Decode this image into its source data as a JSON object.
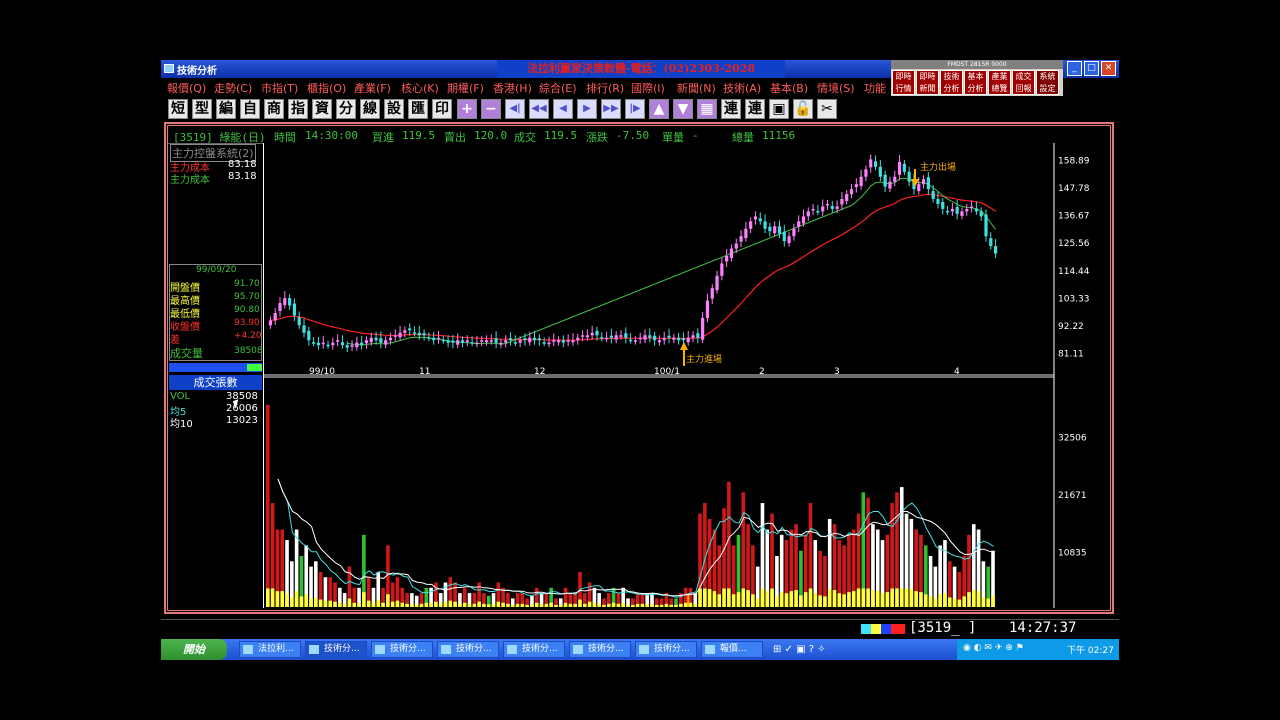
{
  "window": {
    "title": "技術分析",
    "ad_title": "法拉利贏家決策軟體-電話：(02)2303-2028"
  },
  "quick_panel": {
    "header": "FMDST 2815R 0000",
    "buttons": [
      "即時行情",
      "即時新聞",
      "技術分析",
      "基本分析",
      "產業總覽",
      "成交回報",
      "系統設定"
    ]
  },
  "menu": [
    "報價(Q)",
    "走勢(C)",
    "市指(T)",
    "櫃指(O)",
    "產業(F)",
    "核心(K)",
    "期權(F)",
    "香港(H)",
    "綜合(E)",
    "排行(R)",
    "國際(I)",
    "新聞(N)",
    "技術(A)",
    "基本(B)",
    "情境(S)",
    "功能"
  ],
  "toolbar": [
    "短",
    "型",
    "編",
    "自",
    "商",
    "指",
    "資",
    "分",
    "線",
    "設",
    "匯",
    "印",
    "+",
    "−",
    "◀|",
    "◀◀",
    "◀",
    "▶",
    "▶▶",
    "|▶",
    "▲",
    "▼",
    "",
    "連",
    "連",
    "",
    "",
    ""
  ],
  "header": {
    "stock": "[3519] 綠能(日)",
    "time_label": "時間",
    "time": "14:30:00",
    "bid_label": "買進",
    "bid": "119.5",
    "ask_label": "賣出",
    "ask": "120.0",
    "deal_label": "成交",
    "deal": "119.5",
    "change_label": "漲跌",
    "change": "-7.50",
    "single_label": "單量",
    "single": "-",
    "total_label": "總量",
    "total": "11156"
  },
  "indicator": {
    "title": "主力控盤系統(2)",
    "line1_label": "主力成本",
    "line1_value": "83.18",
    "line2_label": "主力成本",
    "line2_value": "83.18"
  },
  "daybox": {
    "date": "99/09/20",
    "open_label": "開盤價",
    "open": "91.70",
    "high_label": "最高價",
    "high": "95.70",
    "low_label": "最低價",
    "low": "90.80",
    "close_label": "收盤價",
    "close": "93.90",
    "diff_label": "差",
    "diff": "+4.20",
    "vol_label": "成交量",
    "vol": "38508"
  },
  "volpanel": {
    "title": "成交張數",
    "vol_label": "VOL",
    "vol": "38508",
    "ma5_label": "均5",
    "ma5": "26006",
    "ma10_label": "均10",
    "ma10": "13023"
  },
  "annotations": {
    "enter": "主力進場",
    "exit": "主力出場"
  },
  "statusbar": {
    "code": "[3519_ ]",
    "time": "14:27:37"
  },
  "taskbar": {
    "start": "開始",
    "tasks": [
      "法拉利...",
      "技術分...",
      "技術分...",
      "技術分...",
      "技術分...",
      "技術分...",
      "技術分...",
      "報價..."
    ],
    "clock": "下午 02:27"
  },
  "colors": {
    "up": "#ff80ff",
    "down": "#40e0e0",
    "cost_line": "#ff2020",
    "avg_line": "#40c040",
    "vol_up": "#d01818",
    "vol_down": "#ffffff",
    "vol_base": "#ffff40"
  },
  "chart_data": [
    {
      "type": "candlestick",
      "x_ticks": [
        "99/10",
        "11",
        "12",
        "100/1",
        "2",
        "3",
        "4"
      ],
      "y_ticks": [
        81.11,
        92.22,
        103.33,
        114.44,
        125.56,
        136.67,
        147.78,
        158.89
      ],
      "ylim": [
        76,
        164
      ],
      "closes": [
        94,
        97,
        101,
        103,
        100,
        96,
        92,
        89,
        86,
        85,
        84,
        85,
        84,
        85,
        86,
        84,
        83,
        84,
        85,
        84,
        86,
        87,
        86,
        85,
        86,
        87,
        88,
        89,
        90,
        90,
        89,
        88,
        88,
        87,
        86,
        87,
        86,
        85,
        85,
        86,
        85,
        86,
        85,
        85,
        86,
        86,
        86,
        85,
        85,
        86,
        86,
        85,
        86,
        86,
        87,
        86,
        86,
        85,
        85,
        86,
        86,
        85,
        86,
        86,
        87,
        88,
        88,
        89,
        88,
        87,
        87,
        87,
        88,
        88,
        87,
        86,
        86,
        87,
        88,
        87,
        86,
        86,
        87,
        87,
        87,
        86,
        86,
        87,
        88,
        87,
        95,
        102,
        107,
        112,
        117,
        120,
        123,
        125,
        128,
        131,
        134,
        136,
        134,
        131,
        130,
        132,
        129,
        126,
        128,
        131,
        134,
        136,
        138,
        139,
        138,
        140,
        141,
        139,
        140,
        143,
        145,
        147,
        149,
        152,
        155,
        159,
        156,
        152,
        148,
        150,
        152,
        158,
        154,
        150,
        147,
        149,
        151,
        147,
        143,
        141,
        139,
        138,
        139,
        137,
        138,
        139,
        140,
        138,
        136,
        128,
        124,
        121
      ]
    },
    {
      "type": "bar",
      "y_ticks": [
        10835,
        21671,
        32506
      ],
      "ylim": [
        0,
        40000
      ],
      "volumes": [
        38508,
        20000,
        15000,
        15000,
        13000,
        9000,
        15000,
        10000,
        12000,
        8000,
        9000,
        7000,
        6000,
        6000,
        5000,
        4000,
        3000,
        8000,
        4000,
        4000,
        14000,
        6000,
        4000,
        7000,
        4000,
        12000,
        5000,
        6000,
        4000,
        3000,
        3000,
        2500,
        3000,
        4000,
        4000,
        5000,
        3000,
        5000,
        6000,
        5000,
        3000,
        4000,
        3000,
        3000,
        5000,
        3000,
        2500,
        3000,
        5000,
        4000,
        3000,
        2000,
        3000,
        3000,
        2000,
        2500,
        4000,
        3000,
        3000,
        4000,
        2000,
        2000,
        4000,
        3000,
        3000,
        7000,
        3000,
        5000,
        4000,
        3000,
        2000,
        3000,
        4000,
        3000,
        4000,
        2000,
        2000,
        3000,
        3000,
        3000,
        3000,
        2000,
        2000,
        3000,
        2000,
        2000,
        3000,
        4000,
        4000,
        3000,
        18000,
        20000,
        17000,
        15000,
        12000,
        19000,
        24000,
        12000,
        14000,
        22000,
        16000,
        12000,
        8000,
        20000,
        15000,
        18000,
        10000,
        14000,
        13000,
        15000,
        16000,
        11000,
        14000,
        20000,
        13000,
        11000,
        10000,
        17000,
        16000,
        13000,
        12000,
        14000,
        15000,
        18000,
        22000,
        21000,
        16000,
        15000,
        13000,
        14000,
        20000,
        22000,
        23000,
        18000,
        17000,
        15000,
        14000,
        12000,
        10000,
        8000,
        12000,
        13000,
        9000,
        8000,
        7000,
        10000,
        14000,
        16000,
        15000,
        9000,
        8000,
        11000
      ]
    }
  ]
}
